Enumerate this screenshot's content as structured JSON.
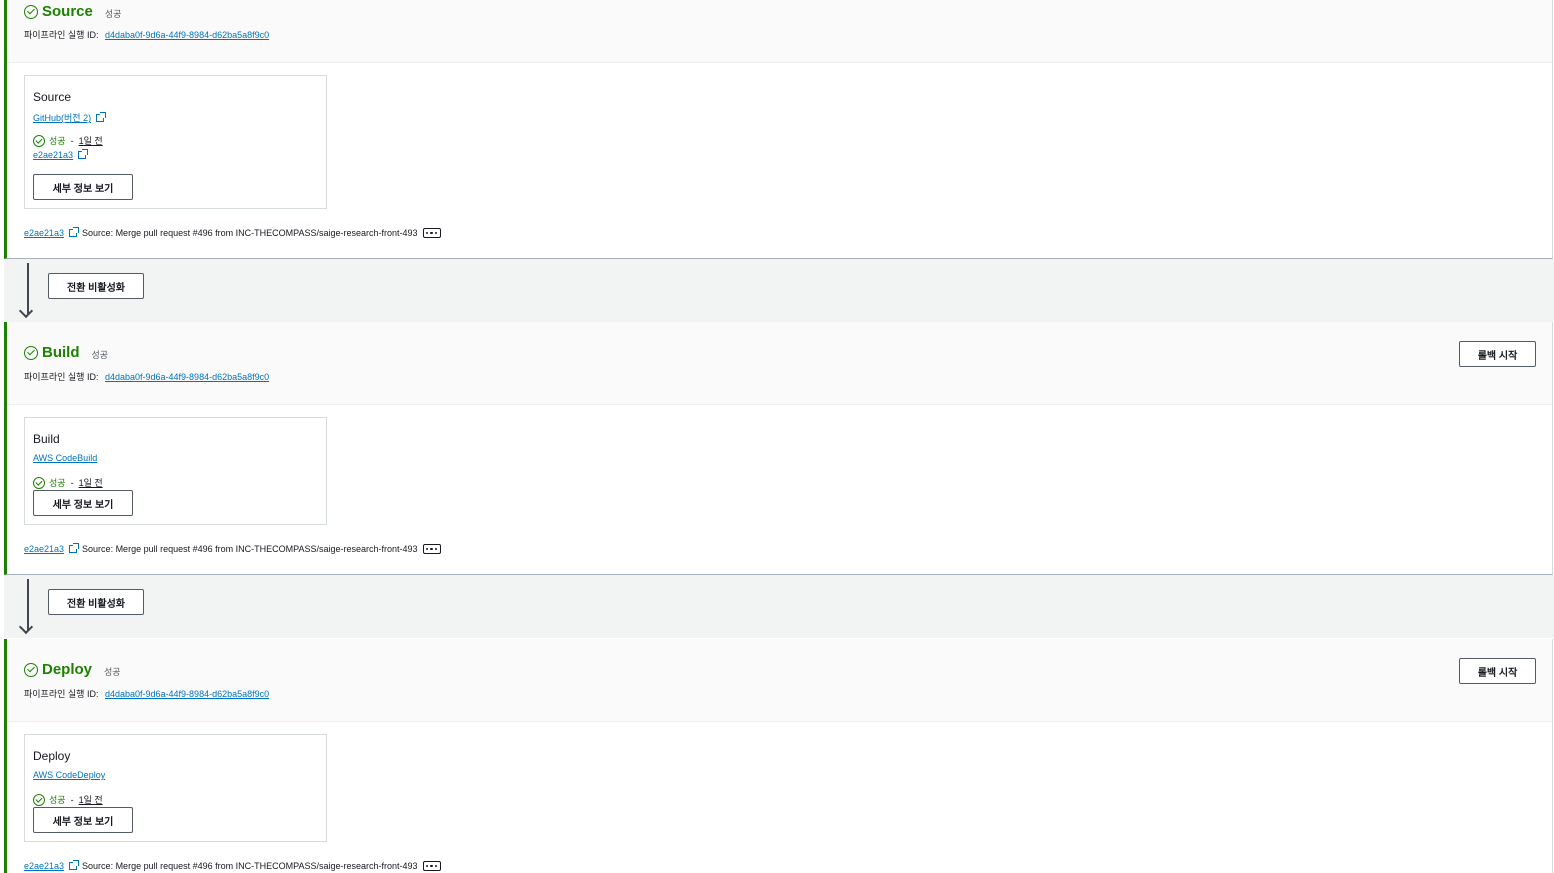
{
  "common": {
    "exec_label": "파이프라인 실행 ID:",
    "exec_id": "d4daba0f-9d6a-44f9-8984-d62ba5a8f9c0",
    "status": "성공",
    "dash": "-",
    "time_ago": "1일 전",
    "detail_button": "세부 정보 보기",
    "rollback_button": "롤백 시작",
    "commit_id": "e2ae21a3",
    "commit_message": "Source: Merge pull request #496 from INC-THECOMPASS/saige-research-front-493",
    "colors": {
      "success": "#1d8102",
      "link": "#0073bb"
    }
  },
  "stages": [
    {
      "name": "Source",
      "status": "성공",
      "action": {
        "name": "Source",
        "provider": "GitHub(버전 2)",
        "revision": "e2ae21a3"
      }
    },
    {
      "name": "Build",
      "status": "성공",
      "action": {
        "name": "Build",
        "provider": "AWS CodeBuild"
      }
    },
    {
      "name": "Deploy",
      "status": "성공",
      "action": {
        "name": "Deploy",
        "provider": "AWS CodeDeploy"
      }
    }
  ],
  "transitions": [
    {
      "button": "전환 비활성화"
    },
    {
      "button": "전환 비활성화"
    }
  ],
  "icons": {
    "success": "check-circle-icon",
    "external": "external-link-icon",
    "more": "ellipsis-icon",
    "transition": "arrow-down-icon"
  }
}
